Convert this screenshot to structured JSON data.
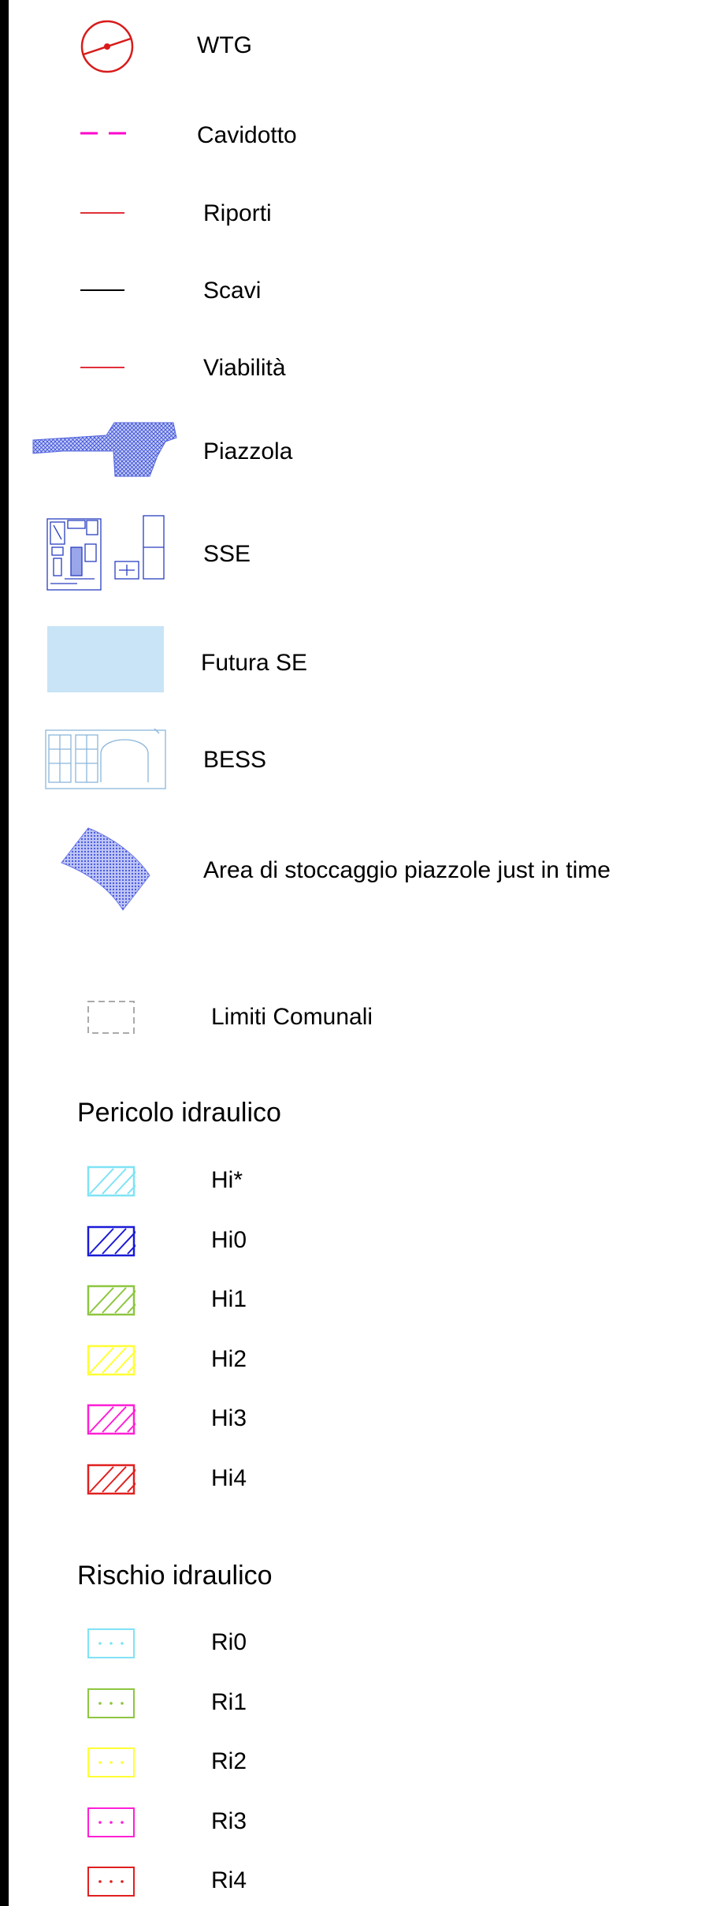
{
  "legend": {
    "items": [
      {
        "label": "WTG",
        "icon": "wtg-turbine-icon",
        "color": "#d81b1b"
      },
      {
        "label": "Cavidotto",
        "icon": "dashed-line-icon",
        "color": "#ff00cc"
      },
      {
        "label": "Riporti",
        "icon": "line-icon",
        "color": "#e0303a"
      },
      {
        "label": "Scavi",
        "icon": "line-icon",
        "color": "#000000"
      },
      {
        "label": "Viabilità",
        "icon": "line-icon",
        "color": "#e0303a"
      },
      {
        "label": "Piazzola",
        "icon": "hatched-area-icon",
        "color": "#3b4fd8"
      },
      {
        "label": "SSE",
        "icon": "substation-plan-icon",
        "color": "#2a3fc0"
      },
      {
        "label": "Futura SE",
        "icon": "filled-rect-icon",
        "color": "#c8e4f6"
      },
      {
        "label": "BESS",
        "icon": "bess-plan-icon",
        "color": "#8ab6dc"
      },
      {
        "label": "Area di stoccaggio piazzole just in time",
        "icon": "storage-area-icon",
        "color": "#3f4fe0"
      },
      {
        "label": "Limiti Comunali",
        "icon": "dashed-rect-icon",
        "color": "#aaaaaa"
      }
    ]
  },
  "pericolo": {
    "title": "Pericolo idraulico",
    "items": [
      {
        "label": "Hi*",
        "color": "#7fe3f5"
      },
      {
        "label": "Hi0",
        "color": "#1a1ad8"
      },
      {
        "label": "Hi1",
        "color": "#8dc63f"
      },
      {
        "label": "Hi2",
        "color": "#ffff33"
      },
      {
        "label": "Hi3",
        "color": "#ff1fd6"
      },
      {
        "label": "Hi4",
        "color": "#e02020"
      }
    ]
  },
  "rischio": {
    "title": "Rischio idraulico",
    "items": [
      {
        "label": "Ri0",
        "color": "#7fe3f5"
      },
      {
        "label": "Ri1",
        "color": "#8dc63f"
      },
      {
        "label": "Ri2",
        "color": "#ffff33"
      },
      {
        "label": "Ri3",
        "color": "#ff1fd6"
      },
      {
        "label": "Ri4",
        "color": "#e02020"
      }
    ]
  }
}
